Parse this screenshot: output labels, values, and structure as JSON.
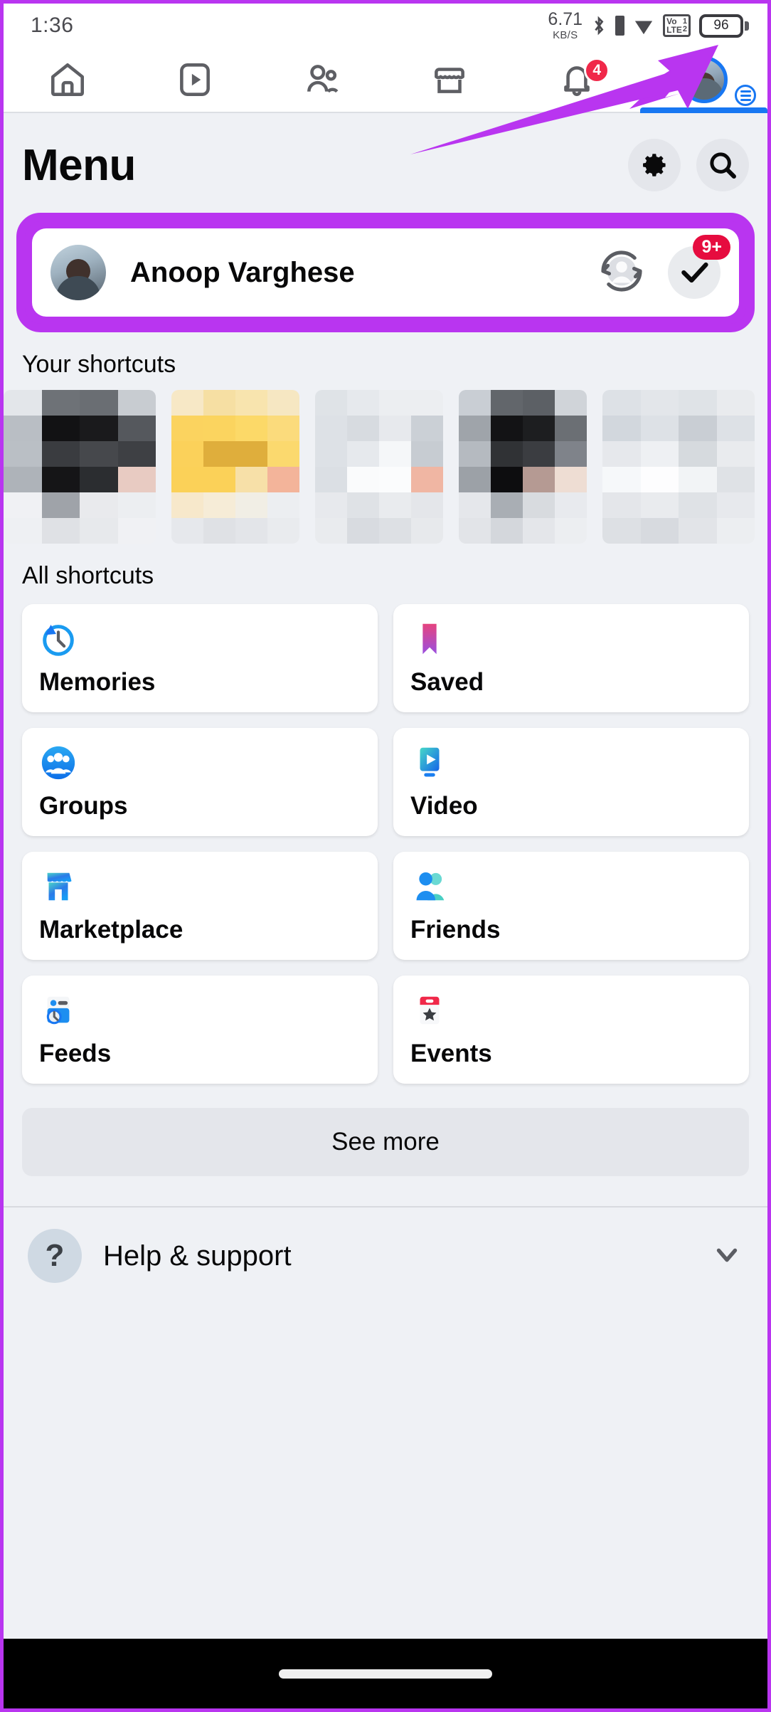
{
  "statusbar": {
    "clock": "1:36",
    "net_rate": "6.71",
    "net_unit": "KB/S",
    "bluetooth_icon": "bluetooth-icon",
    "signal_icon": "signal-icon",
    "wifi_icon": "wifi-icon",
    "volte_label": "Vo",
    "volte_sub": "LTE",
    "volte_sim1": "1",
    "volte_sim2": "2",
    "battery_level": "96"
  },
  "topnav": {
    "tabs": [
      {
        "name": "home-tab",
        "icon": "home-icon"
      },
      {
        "name": "video-tab",
        "icon": "video-icon"
      },
      {
        "name": "friends-tab",
        "icon": "friends-icon"
      },
      {
        "name": "marketplace-tab",
        "icon": "marketplace-icon"
      },
      {
        "name": "notifications-tab",
        "icon": "bell-icon",
        "badge": "4"
      },
      {
        "name": "menu-tab",
        "icon": "profile-avatar-icon",
        "active": true
      }
    ]
  },
  "header": {
    "title": "Menu",
    "settings_icon": "gear-icon",
    "search_icon": "search-icon"
  },
  "profile": {
    "name": "Anoop Varghese",
    "avatar_icon": "profile-photo",
    "switch_account_icon": "switch-account-icon",
    "check_icon": "check-icon",
    "badge": "9+",
    "highlight_color": "#b935f0"
  },
  "your_shortcuts": {
    "title": "Your shortcuts",
    "tiles": [
      {
        "name": "shortcut-thumbnail-1"
      },
      {
        "name": "shortcut-thumbnail-2"
      },
      {
        "name": "shortcut-thumbnail-3"
      },
      {
        "name": "shortcut-thumbnail-4"
      },
      {
        "name": "shortcut-thumbnail-5"
      }
    ]
  },
  "all_shortcuts": {
    "title": "All shortcuts",
    "items": [
      {
        "label": "Memories",
        "icon": "memories-icon"
      },
      {
        "label": "Saved",
        "icon": "saved-bookmark-icon"
      },
      {
        "label": "Groups",
        "icon": "groups-icon"
      },
      {
        "label": "Video",
        "icon": "video-icon"
      },
      {
        "label": "Marketplace",
        "icon": "marketplace-icon"
      },
      {
        "label": "Friends",
        "icon": "friends-icon"
      },
      {
        "label": "Feeds",
        "icon": "feeds-icon"
      },
      {
        "label": "Events",
        "icon": "events-icon"
      }
    ],
    "see_more_label": "See more"
  },
  "help": {
    "label": "Help & support",
    "icon": "question-mark-icon",
    "chevron": "chevron-down-icon"
  },
  "system": {
    "home_indicator": "home-indicator"
  },
  "annotation": {
    "arrow_color": "#b935f0"
  }
}
